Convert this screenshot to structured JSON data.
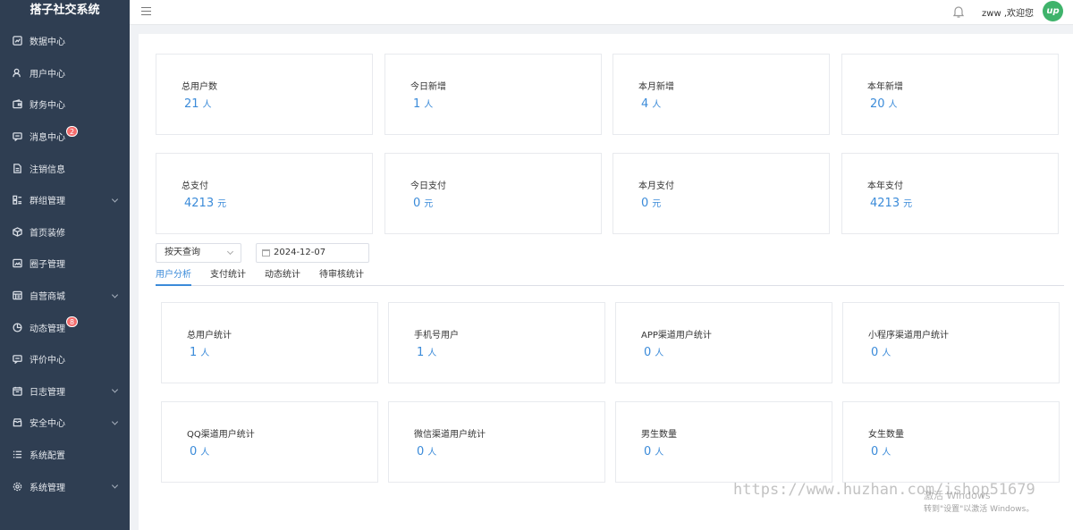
{
  "app": {
    "title": "搭子社交系统"
  },
  "sidebar": {
    "items": [
      {
        "label": "数据中心",
        "icon": "dashboard-icon",
        "badge": "",
        "expandable": false
      },
      {
        "label": "用户中心",
        "icon": "user-icon",
        "badge": "",
        "expandable": false
      },
      {
        "label": "财务中心",
        "icon": "wallet-icon",
        "badge": "",
        "expandable": false
      },
      {
        "label": "消息中心",
        "icon": "message-icon",
        "badge": "2",
        "expandable": false
      },
      {
        "label": "注销信息",
        "icon": "document-icon",
        "badge": "",
        "expandable": false
      },
      {
        "label": "群组管理",
        "icon": "group-icon",
        "badge": "",
        "expandable": true
      },
      {
        "label": "首页装修",
        "icon": "box-icon",
        "badge": "",
        "expandable": false
      },
      {
        "label": "圈子管理",
        "icon": "image-icon",
        "badge": "",
        "expandable": false
      },
      {
        "label": "自营商城",
        "icon": "shop-icon",
        "badge": "",
        "expandable": true
      },
      {
        "label": "动态管理",
        "icon": "activity-icon",
        "badge": "8",
        "expandable": false
      },
      {
        "label": "评价中心",
        "icon": "comment-icon",
        "badge": "",
        "expandable": false
      },
      {
        "label": "日志管理",
        "icon": "calendar-icon",
        "badge": "",
        "expandable": true
      },
      {
        "label": "安全中心",
        "icon": "shield-icon",
        "badge": "",
        "expandable": true
      },
      {
        "label": "系统配置",
        "icon": "list-icon",
        "badge": "",
        "expandable": false
      },
      {
        "label": "系统管理",
        "icon": "gear-icon",
        "badge": "",
        "expandable": true
      }
    ]
  },
  "header": {
    "menu_icon": "hamburger-icon",
    "bell_icon": "bell-icon",
    "welcome": "zww ,欢迎您",
    "avatar_text": "up"
  },
  "summary": {
    "row1": [
      {
        "label": "总用户数",
        "value": "21",
        "unit": "人"
      },
      {
        "label": "今日新增",
        "value": "1",
        "unit": "人"
      },
      {
        "label": "本月新增",
        "value": "4",
        "unit": "人"
      },
      {
        "label": "本年新增",
        "value": "20",
        "unit": "人"
      }
    ],
    "row2": [
      {
        "label": "总支付",
        "value": "4213",
        "unit": "元"
      },
      {
        "label": "今日支付",
        "value": "0",
        "unit": "元"
      },
      {
        "label": "本月支付",
        "value": "0",
        "unit": "元"
      },
      {
        "label": "本年支付",
        "value": "4213",
        "unit": "元"
      }
    ]
  },
  "filters": {
    "query_mode": "按天查询",
    "date": "2024-12-07"
  },
  "tabs": [
    {
      "label": "用户分析",
      "active": true
    },
    {
      "label": "支付统计",
      "active": false
    },
    {
      "label": "动态统计",
      "active": false
    },
    {
      "label": "待审核统计",
      "active": false
    }
  ],
  "analysis": {
    "row1": [
      {
        "label": "总用户统计",
        "value": "1",
        "unit": "人"
      },
      {
        "label": "手机号用户",
        "value": "1",
        "unit": "人"
      },
      {
        "label": "APP渠道用户统计",
        "value": "0",
        "unit": "人"
      },
      {
        "label": "小程序渠道用户统计",
        "value": "0",
        "unit": "人"
      }
    ],
    "row2": [
      {
        "label": "QQ渠道用户统计",
        "value": "0",
        "unit": "人"
      },
      {
        "label": "微信渠道用户统计",
        "value": "0",
        "unit": "人"
      },
      {
        "label": "男生数量",
        "value": "0",
        "unit": "人"
      },
      {
        "label": "女生数量",
        "value": "0",
        "unit": "人"
      }
    ]
  },
  "watermark": {
    "url": "https://www.huzhan.com/ishop51679",
    "activate_title": "激活 Windows",
    "activate_hint": "转到\"设置\"以激活 Windows。"
  },
  "colors": {
    "sidebar_bg": "#2f3e52",
    "accent": "#3b8bd9",
    "badge": "#f56c6c",
    "avatar": "#3fb36b"
  }
}
